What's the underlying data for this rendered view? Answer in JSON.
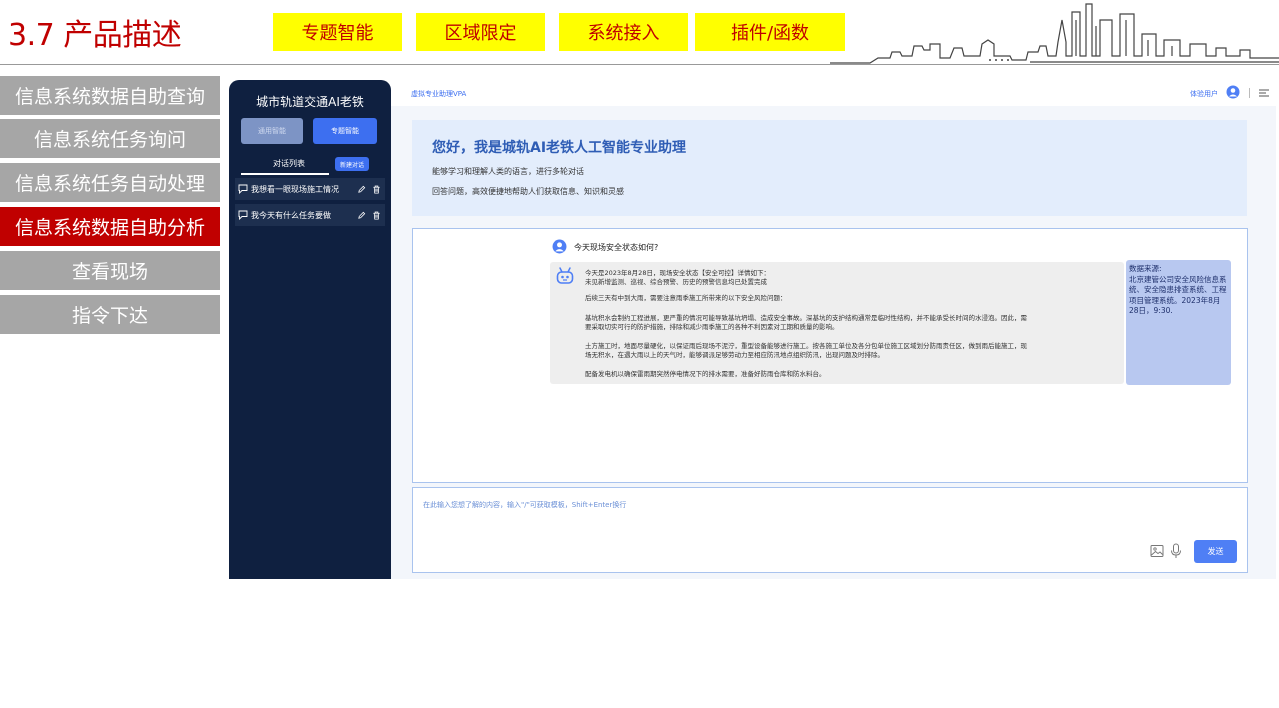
{
  "slide": {
    "title": "3.7 产品描述",
    "tags": [
      "专题智能",
      "区域限定",
      "系统接入",
      "插件/函数"
    ]
  },
  "left_menu": {
    "items": [
      {
        "label": "信息系统数据自助查询",
        "active": false
      },
      {
        "label": "信息系统任务询问",
        "active": false
      },
      {
        "label": "信息系统任务自动处理",
        "active": false
      },
      {
        "label": "信息系统数据自助分析",
        "active": true
      },
      {
        "label": "查看现场",
        "active": false
      },
      {
        "label": "指令下达",
        "active": false
      }
    ]
  },
  "sidebar": {
    "title": "城市轨道交通AI老铁",
    "mode_general": "通用智能",
    "mode_special": "专题智能",
    "list_title": "对话列表",
    "new_chat": "新建对话",
    "conversations": [
      "我想看一眼现场施工情况",
      "我今天有什么任务要做"
    ]
  },
  "topbar": {
    "vpa": "虚拟专业助理VPA",
    "user": "体验用户"
  },
  "welcome": {
    "title": "您好，我是城轨AI老铁人工智能专业助理",
    "line1": "能够学习和理解人类的语言，进行多轮对话",
    "line2": "回答问题，高效便捷地帮助人们获取信息、知识和灵感"
  },
  "chat": {
    "question": "今天现场安全状态如何?",
    "answer": {
      "l1": "今天是2023年8月28日，现场安全状态【安全可控】详情如下：",
      "l2": "未见新增监测、巡视、综合预警、历史的预警信息均已处置完成",
      "l3": "后续三天有中到大雨，需要注意雨季施工所带来的以下安全风险问题：",
      "l4": "基坑积水会制约工程进展，更严重的情况可能导致基坑坍塌、造成安全事故。深基坑的支护结构通常是临时性结构，并不能承受长时间的水浸泡。因此，需",
      "l5": "要采取切实可行的防护措施，排除和减少雨季施工的各种不利因素对工期和质量的影响。",
      "l6": "土方施工时，地面尽量硬化，以保证雨后现场不泥泞，重型设备能够进行施工。按各施工单位及各分包单位施工区域划分防雨责任区，做到雨后能施工，现",
      "l7": "场无积水，在遇大雨以上的天气时，能够调派足够劳动力至相应防汛地点组织防汛，出现问题及时排除。",
      "l8": "配备发电机以确保雷雨期突然停电情况下的排水需要，准备好防雨仓库和防水料台。"
    },
    "source": "数据来源:\n北京建管公司安全风险信息系统、安全隐患排查系统、工程项目管理系统。2023年8月28日，9:30."
  },
  "input": {
    "placeholder": "在此输入您想了解的内容，输入\"/\"可获取模板，Shift+Enter换行",
    "send": "发送"
  },
  "colors": {
    "title_red": "#c00000",
    "tag_yellow": "#ffff00",
    "menu_gray": "#a6a6a6",
    "sidebar_navy": "#0f2040",
    "accent_blue": "#3d6ff0"
  }
}
